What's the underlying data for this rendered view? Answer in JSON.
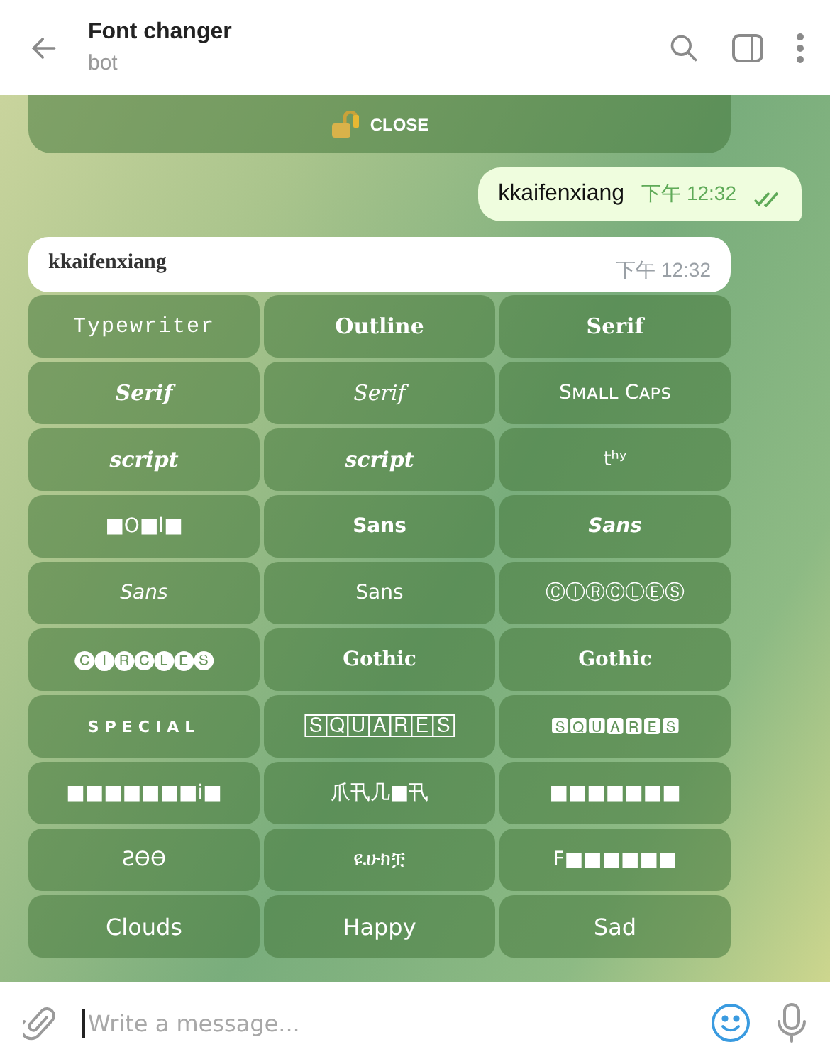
{
  "header": {
    "title": "Font changer",
    "subtitle": "bot"
  },
  "close_button": {
    "label": "CLOSE"
  },
  "messages": [
    {
      "kind": "outgoing",
      "text": "kkaifenxiang",
      "time": "下午 12:32",
      "read": true
    },
    {
      "kind": "incoming",
      "text": "kkaifenxiang",
      "time": "下午 12:32"
    }
  ],
  "keyboard": [
    [
      {
        "label": "Typewriter",
        "kind": "mono"
      },
      {
        "label": "Outline",
        "kind": "serif-bold"
      },
      {
        "label": "Serif",
        "kind": "serif-bold"
      }
    ],
    [
      {
        "label": "Serif",
        "kind": "serif-bold-italic"
      },
      {
        "label": "Serif",
        "kind": "serif-italic"
      },
      {
        "label": "Sᴍᴀʟʟ Cᴀᴘꜱ",
        "kind": "plain"
      }
    ],
    [
      {
        "label": "script",
        "kind": "serif-bold-italic"
      },
      {
        "label": "script",
        "kind": "serif-bold-italic"
      },
      {
        "label": "tʰʸ",
        "kind": "plain"
      }
    ],
    [
      {
        "label": "■O■l■",
        "kind": "plain"
      },
      {
        "label": "Sans",
        "kind": "sans-bold"
      },
      {
        "label": "Sans",
        "kind": "sans-bold-italic"
      }
    ],
    [
      {
        "label": "Sans",
        "kind": "sans-italic"
      },
      {
        "label": "Sans",
        "kind": "plain"
      },
      {
        "label": "ⒸⒾⓇⒸⓁⒺⓈ",
        "kind": "plain"
      }
    ],
    [
      {
        "label": "🅒🅘🅡🅒🅛🅔🅢",
        "kind": "plain"
      },
      {
        "label": "Gothic",
        "kind": "gothic"
      },
      {
        "label": "Gothic",
        "kind": "gothic"
      }
    ],
    [
      {
        "label": "SPECIAL",
        "kind": "spaced"
      },
      {
        "label": "🅂🅀🅄🄰🅁🄴🅂",
        "kind": "plain"
      },
      {
        "label": "🆂🆀🆄🅰🆁🅴🆂",
        "kind": "plain"
      }
    ],
    [
      {
        "label": "■■■■■■■i■",
        "kind": "plain"
      },
      {
        "label": "爪卂几■卂",
        "kind": "plain"
      },
      {
        "label": "■■■■■■■",
        "kind": "plain"
      }
    ],
    [
      {
        "label": "ƧӨӨ",
        "kind": "plain"
      },
      {
        "label": "ዪሁክቿ",
        "kind": "plain"
      },
      {
        "label": "F■■■■■■",
        "kind": "plain"
      }
    ],
    [
      {
        "label": "Clouds",
        "kind": "regular"
      },
      {
        "label": "Happy",
        "kind": "regular"
      },
      {
        "label": "Sad",
        "kind": "regular"
      }
    ]
  ],
  "composer": {
    "placeholder": "Write a message..."
  }
}
